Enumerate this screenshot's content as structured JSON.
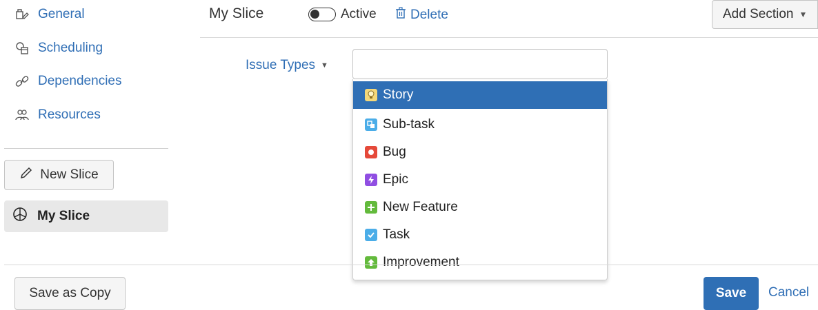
{
  "sidebar": {
    "items": [
      {
        "label": "General",
        "icon": "general-settings-icon"
      },
      {
        "label": "Scheduling",
        "icon": "scheduling-icon"
      },
      {
        "label": "Dependencies",
        "icon": "link-icon"
      },
      {
        "label": "Resources",
        "icon": "people-icon"
      }
    ],
    "new_slice_label": "New Slice",
    "slices": [
      {
        "label": "My Slice",
        "icon": "slice-pie-icon"
      }
    ],
    "save_copy_label": "Save as Copy"
  },
  "header": {
    "title": "My Slice",
    "toggle_label": "Active",
    "toggle_on": false,
    "delete_label": "Delete",
    "add_section_label": "Add Section"
  },
  "issue_types": {
    "label": "Issue Types",
    "input_value": "",
    "options": [
      {
        "label": "Story",
        "color": "#65ba43",
        "selected": true
      },
      {
        "label": "Sub-task",
        "color": "#4bade8",
        "selected": false
      },
      {
        "label": "Bug",
        "color": "#e5493a",
        "selected": false
      },
      {
        "label": "Epic",
        "color": "#904ee2",
        "selected": false
      },
      {
        "label": "New Feature",
        "color": "#63ba3c",
        "selected": false
      },
      {
        "label": "Task",
        "color": "#4bade8",
        "selected": false
      },
      {
        "label": "Improvement",
        "color": "#63ba3c",
        "selected": false
      }
    ]
  },
  "footer": {
    "save_label": "Save",
    "cancel_label": "Cancel"
  },
  "colors": {
    "link": "#2f6eb5",
    "primary": "#2f6fb5"
  }
}
